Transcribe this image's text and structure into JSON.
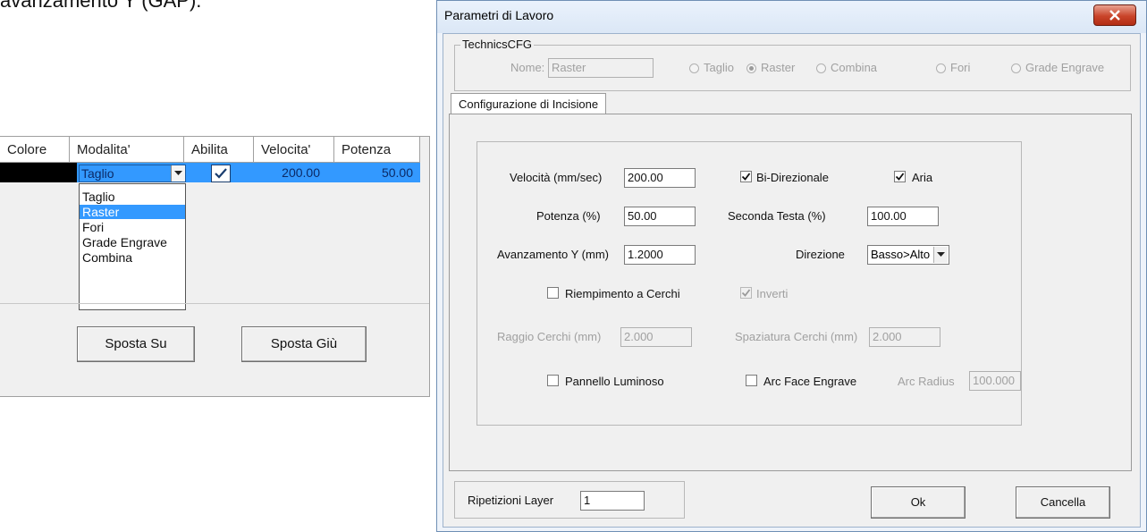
{
  "document": {
    "text": "avanzamento Y (GAP)."
  },
  "layer_grid": {
    "columns": [
      "Colore",
      "Modalita'",
      "Abilita",
      "Velocita'",
      "Potenza"
    ],
    "row": {
      "color": "#000000",
      "mode": "Taglio",
      "enabled": true,
      "speed": "200.00",
      "power": "50.00"
    },
    "mode_options": [
      "Taglio",
      "Raster",
      "Fori",
      "Grade Engrave",
      "Combina"
    ],
    "highlighted_option": "Raster",
    "move_up_label": "Sposta Su",
    "move_down_label": "Sposta Giù"
  },
  "dialog": {
    "title": "Parametri di Lavoro",
    "group_title": "TechnicsCFG",
    "name_label": "Nome:",
    "name_value": "Raster",
    "radio_options": [
      "Taglio",
      "Raster",
      "Combina",
      "Fori",
      "Grade Engrave"
    ],
    "selected_radio": "Raster",
    "tab_label": "Configurazione di Incisione",
    "speed_label": "Velocità (mm/sec)",
    "speed_value": "200.00",
    "bidirectional_label": "Bi-Direzionale",
    "bidirectional_checked": true,
    "air_label": "Aria",
    "air_checked": true,
    "power_label": "Potenza (%)",
    "power_value": "50.00",
    "second_head_label": "Seconda Testa (%)",
    "second_head_value": "100.00",
    "feed_y_label": "Avanzamento Y (mm)",
    "feed_y_value": "1.2000",
    "direction_label": "Direzione",
    "direction_value": "Basso>Alto",
    "circle_fill_label": "Riempimento a Cerchi",
    "circle_fill_checked": false,
    "invert_label": "Inverti",
    "invert_checked": true,
    "circle_radius_label": "Raggio Cerchi (mm)",
    "circle_radius_value": "2.000",
    "circle_spacing_label": "Spaziatura Cerchi (mm)",
    "circle_spacing_value": "2.000",
    "light_panel_label": "Pannello Luminoso",
    "light_panel_checked": false,
    "arc_face_label": "Arc Face Engrave",
    "arc_face_checked": false,
    "arc_radius_label": "Arc Radius",
    "arc_radius_value": "100.000",
    "repeat_label": "Ripetizioni Layer",
    "repeat_value": "1",
    "ok_label": "Ok",
    "cancel_label": "Cancella"
  },
  "colors": {
    "selection": "#3399ff",
    "close_button": "#c9442a",
    "window_border": "#6f8fb5"
  }
}
